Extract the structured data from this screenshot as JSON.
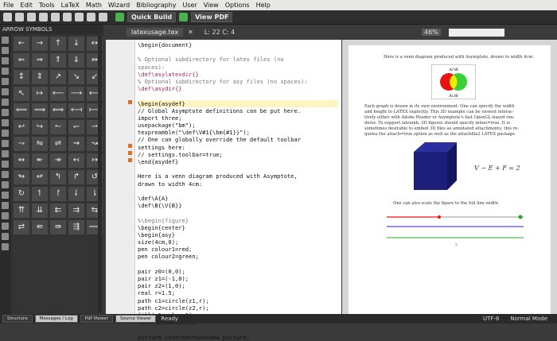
{
  "menu": [
    "File",
    "Edit",
    "Tools",
    "LaTeX",
    "Math",
    "Wizard",
    "Bibliography",
    "User",
    "View",
    "Options",
    "Help"
  ],
  "toolbar": {
    "quick_build": "Quick Build",
    "view_pdf": "View PDF"
  },
  "left_panel": {
    "title": "ARROW SYMBOLS",
    "symbols": [
      "←",
      "→",
      "↑",
      "↓",
      "↔",
      "⇐",
      "⇒",
      "⇑",
      "⇓",
      "⇔",
      "↕",
      "⇕",
      "↗",
      "↘",
      "↙",
      "↖",
      "↦",
      "⟵",
      "⟶",
      "⟷",
      "⟸",
      "⟹",
      "⟺",
      "⟻",
      "⟼",
      "↩",
      "↪",
      "↼",
      "↽",
      "⇀",
      "⇁",
      "⇋",
      "⇌",
      "⇝",
      "↝",
      "↭",
      "↞",
      "↠",
      "↢",
      "↣",
      "↬",
      "↫",
      "↰",
      "↱",
      "↺",
      "↻",
      "↿",
      "↾",
      "⇃",
      "⇂",
      "⇈",
      "⇊",
      "⇇",
      "⇉",
      "⇆",
      "⇄",
      "⇚",
      "⇛",
      "⇶",
      "⟿"
    ]
  },
  "editor": {
    "tab": "latexusage.tex",
    "position": "L: 22 C: 4",
    "lines": [
      {
        "t": "\\begin{document}",
        "c": ""
      },
      {
        "t": "",
        "c": ""
      },
      {
        "t": "% Optional subdirectory for latex files (no",
        "c": "cmt"
      },
      {
        "t": "spaces):",
        "c": "cmt"
      },
      {
        "t": "\\def\\asylatexdir{}",
        "c": "kw"
      },
      {
        "t": "% Optional subdirectory for asy files (no spaces):",
        "c": "cmt"
      },
      {
        "t": "\\def\\asydir{}",
        "c": "kw"
      },
      {
        "t": "",
        "c": ""
      },
      {
        "t": "\\begin{asydef}",
        "c": "cur"
      },
      {
        "t": "// Global Asymptote definitions can be put here.",
        "c": ""
      },
      {
        "t": "import three;",
        "c": ""
      },
      {
        "t": "usepackage(\"bm\");",
        "c": ""
      },
      {
        "t": "texpreamble(\"\\def\\V#1{\\bm{#1}}\");",
        "c": ""
      },
      {
        "t": "// One can globally override the default toolbar",
        "c": ""
      },
      {
        "t": "settings here:",
        "c": ""
      },
      {
        "t": "// settings.toolbar=true;",
        "c": ""
      },
      {
        "t": "\\end{asydef}",
        "c": ""
      },
      {
        "t": "",
        "c": ""
      },
      {
        "t": "Here is a venn diagram produced with Asymptote,",
        "c": ""
      },
      {
        "t": "drawn to width 4cm:",
        "c": ""
      },
      {
        "t": "",
        "c": ""
      },
      {
        "t": "\\def\\A{A}",
        "c": ""
      },
      {
        "t": "\\def\\B{\\V{B}}",
        "c": ""
      },
      {
        "t": "",
        "c": ""
      },
      {
        "t": "%\\begin{figure}",
        "c": "cmt"
      },
      {
        "t": "\\begin{center}",
        "c": ""
      },
      {
        "t": "\\begin{asy}",
        "c": ""
      },
      {
        "t": "size(4cm,0);",
        "c": ""
      },
      {
        "t": "pen colour1=red;",
        "c": ""
      },
      {
        "t": "pen colour2=green;",
        "c": ""
      },
      {
        "t": "",
        "c": ""
      },
      {
        "t": "pair z0=(0,0);",
        "c": ""
      },
      {
        "t": "pair z1=(-1,0);",
        "c": ""
      },
      {
        "t": "pair z2=(1,0);",
        "c": ""
      },
      {
        "t": "real r=1.5;",
        "c": ""
      },
      {
        "t": "path c1=circle(z1,r);",
        "c": ""
      },
      {
        "t": "path c2=circle(z2,r);",
        "c": ""
      },
      {
        "t": "fill(c1,colour1);",
        "c": ""
      },
      {
        "t": "fill(c2,colour2);",
        "c": ""
      },
      {
        "t": "",
        "c": ""
      },
      {
        "t": "picture intersection=new picture;",
        "c": ""
      }
    ]
  },
  "preview": {
    "zoom": "46%",
    "p1": "Here is a venn diagram produced with Asymptote, drawn to width 4cm:",
    "venn_top": "A∩B",
    "venn_bottom": "A∪B",
    "p2a": "Each graph is drawn in its own environment. One can specify the width",
    "p2b": "and height to LATEX explicitly. This 3D example can be viewed interac-",
    "p2c": "tively either with Adobe Reader or Asymptote's fast OpenGL-based ren-",
    "p2d": "derer. To support latexmk, 3D figures should specify inline=true. It is",
    "p2e": "sometimes desirable to embed 3D files as annotated attachments; this re-",
    "p2f": "quires the attach=true option as well as the attachfile2 LATEX package.",
    "formula": "V − E + F = 2",
    "p3": "One can also scale the figure to the full line width:",
    "scale_label": "x"
  },
  "status": {
    "tabs": [
      "Structure",
      "Messages / Log",
      "Pdf Viewer",
      "Source Viewer"
    ],
    "ready": "Ready",
    "encoding": "UTF-8",
    "mode": "Normal Mode"
  }
}
